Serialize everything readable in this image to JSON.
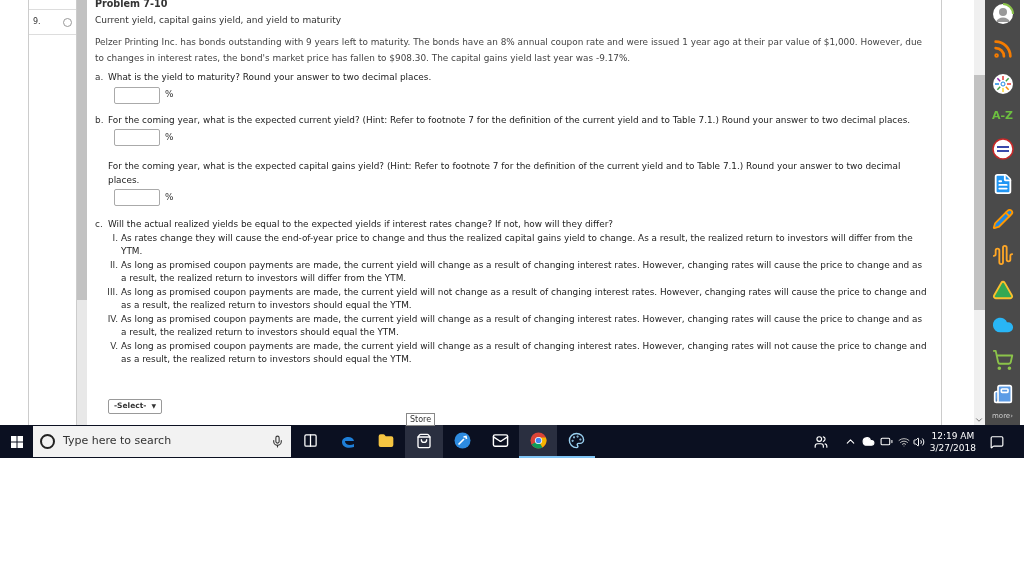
{
  "nav": {
    "items": [
      {
        "label": "9.",
        "selected": false
      }
    ]
  },
  "problem": {
    "title": "Problem 7-10",
    "subtitle": "Current yield, capital gains yield, and yield to maturity",
    "intro": "Pelzer Printing Inc. has bonds outstanding with 9 years left to maturity. The bonds have an 8% annual coupon rate and were issued 1 year ago at their par value of $1,000. However, due to changes in interest rates, the bond's market price has fallen to $908.30. The capital gains yield last year was -9.17%.",
    "parts": [
      {
        "kind": "numeric",
        "label": "a.",
        "text": "What is the yield to maturity? Round your answer to two decimal places.",
        "unit": "%"
      },
      {
        "kind": "numeric",
        "label": "b.",
        "text": "For the coming year, what is the expected current yield? (Hint: Refer to footnote 7 for the definition of the current yield and to Table 7.1.) Round your answer to two decimal places.",
        "unit": "%"
      },
      {
        "kind": "numeric",
        "text": "For the coming year, what is the expected capital gains yield? (Hint: Refer to footnote 7 for the definition of the current yield and to Table 7.1.) Round your answer to two decimal places.",
        "unit": "%"
      },
      {
        "kind": "choice",
        "label": "c.",
        "text": "Will the actual realized yields be equal to the expected yields if interest rates change? If not, how will they differ?",
        "options": [
          {
            "numeral": "I.",
            "text": "As rates change they will cause the end-of-year price to change and thus the realized capital gains yield to change. As a result, the realized return to investors will differ from the YTM."
          },
          {
            "numeral": "II.",
            "text": "As long as promised coupon payments are made, the current yield will change as a result of changing interest rates. However, changing rates will cause the price to change and as a result, the realized return to investors will differ from the YTM."
          },
          {
            "numeral": "III.",
            "text": "As long as promised coupon payments are made, the current yield will not change as a result of changing interest rates. However, changing rates will cause the price to change and as a result, the realized return to investors should equal the YTM."
          },
          {
            "numeral": "IV.",
            "text": "As long as promised coupon payments are made, the current yield will change as a result of changing interest rates. However, changing rates will cause the price to change and as a result, the realized return to investors should equal the YTM."
          },
          {
            "numeral": "V.",
            "text": "As long as promised coupon payments are made, the current yield will change as a result of changing interest rates. However, changing rates will not cause the price to change and as a result, the realized return to investors should equal the YTM."
          }
        ],
        "select": "-Select-",
        "select_caret": "▼"
      }
    ]
  },
  "sidebar": {
    "az_label": "A-Z",
    "more_label": "more›"
  },
  "tooltip": "Store",
  "taskbar": {
    "search_placeholder": "Type here to search",
    "apps": [
      {
        "kind": "taskview",
        "active": false,
        "running": false
      },
      {
        "kind": "edge",
        "active": false,
        "running": false
      },
      {
        "kind": "folder",
        "active": false,
        "running": false
      },
      {
        "kind": "store",
        "active": true,
        "running": false
      },
      {
        "kind": "tool",
        "active": false,
        "running": false
      },
      {
        "kind": "mail",
        "active": false,
        "running": false
      },
      {
        "kind": "chrome",
        "active": true,
        "running": true
      },
      {
        "kind": "paint",
        "active": false,
        "running": true
      }
    ],
    "time": "12:19 AM",
    "date": "3/27/2018"
  }
}
